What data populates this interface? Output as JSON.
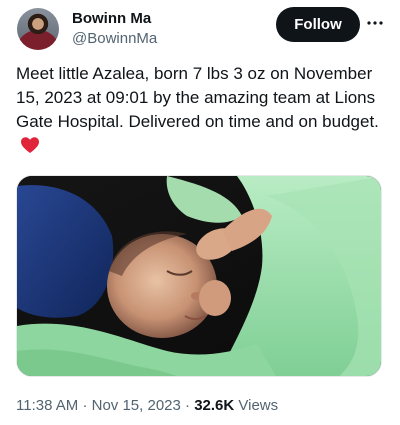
{
  "author": {
    "name": "Bowinn Ma",
    "handle": "@BowinnMa"
  },
  "follow_label": "Follow",
  "more_icon": "more-horizontal-icon",
  "tweet": {
    "text": "Meet little Azalea, born 7 lbs 3 oz on November 15, 2023 at 09:01 by the amazing team at Lions Gate Hospital. Delivered on time and on budget.",
    "emoji_icon": "red-heart-icon"
  },
  "meta": {
    "time": "11:38 AM",
    "separator": "·",
    "date": "Nov 15, 2023",
    "views_count": "32.6K",
    "views_label": "Views"
  },
  "colors": {
    "text": "#0f1419",
    "secondary": "#536471",
    "heart": "#f91880",
    "blanket": "#9fd8a8"
  }
}
